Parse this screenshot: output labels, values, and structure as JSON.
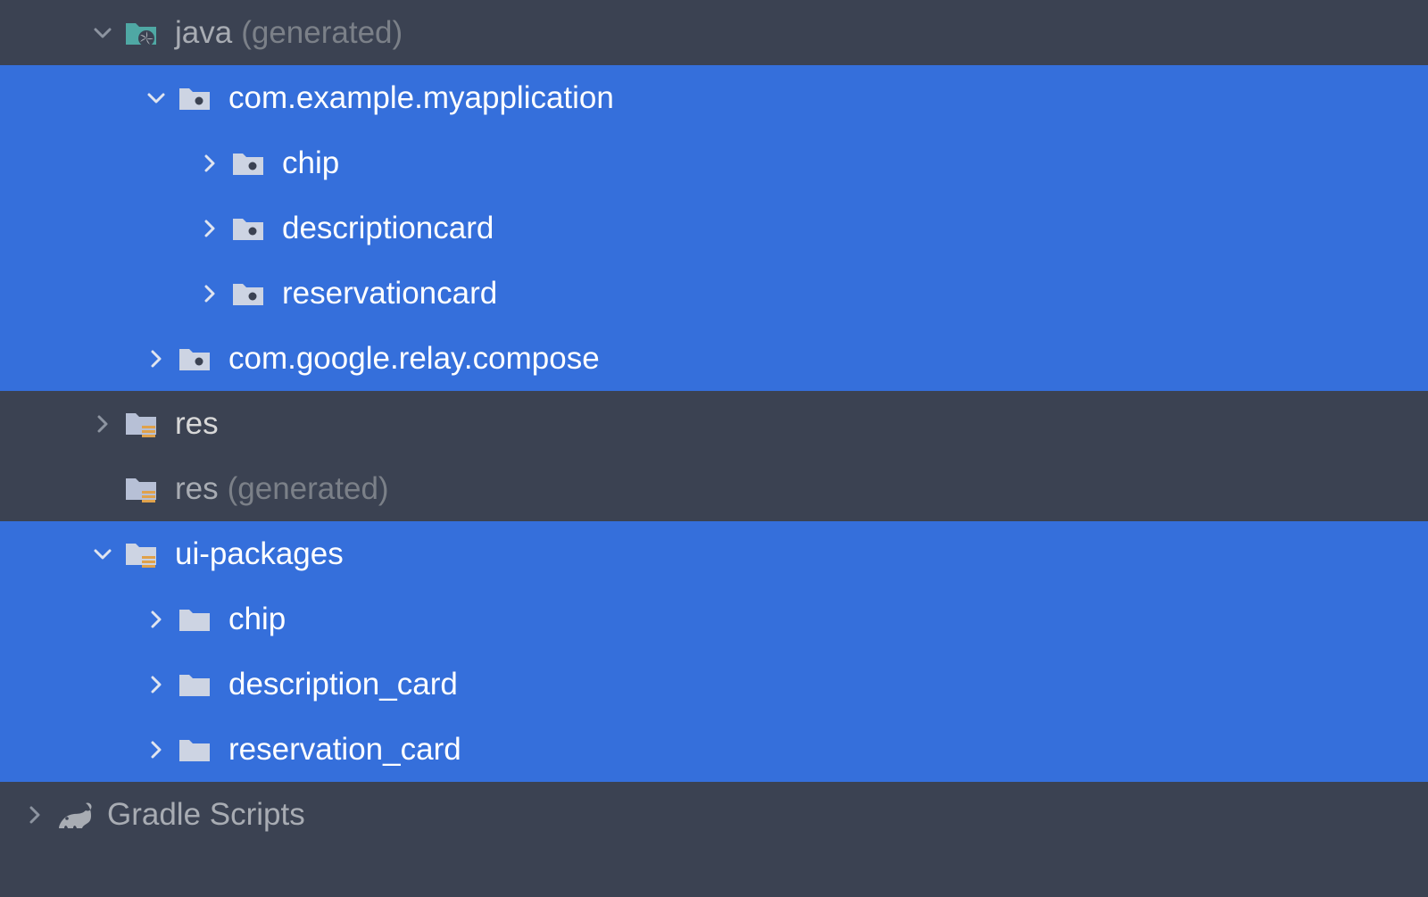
{
  "tree": {
    "javaGen": {
      "label": "java",
      "annot": "(generated)"
    },
    "pkgApp": {
      "label": "com.example.myapplication"
    },
    "pkgChip": {
      "label": "chip"
    },
    "pkgDesc": {
      "label": "descriptioncard"
    },
    "pkgResv": {
      "label": "reservationcard"
    },
    "pkgRelay": {
      "label": "com.google.relay.compose"
    },
    "res": {
      "label": "res"
    },
    "resGen": {
      "label": "res",
      "annot": "(generated)"
    },
    "uiPkgs": {
      "label": "ui-packages"
    },
    "uiChip": {
      "label": "chip"
    },
    "uiDesc": {
      "label": "description_card"
    },
    "uiResv": {
      "label": "reservation_card"
    },
    "gradle": {
      "label": "Gradle Scripts"
    }
  },
  "indent": {
    "root": 18,
    "l1": 94,
    "l2": 154,
    "l3": 214,
    "l4": 274
  },
  "colors": {
    "bg": "#3b4252",
    "sel": "#356FDB",
    "tealFolder": "#4fa8a4",
    "folderLight": "#b7c0d6",
    "arrowDim": "#8d94a0",
    "arrowSel": "#e0e5f0",
    "orangeLines": "#e0a24b"
  }
}
